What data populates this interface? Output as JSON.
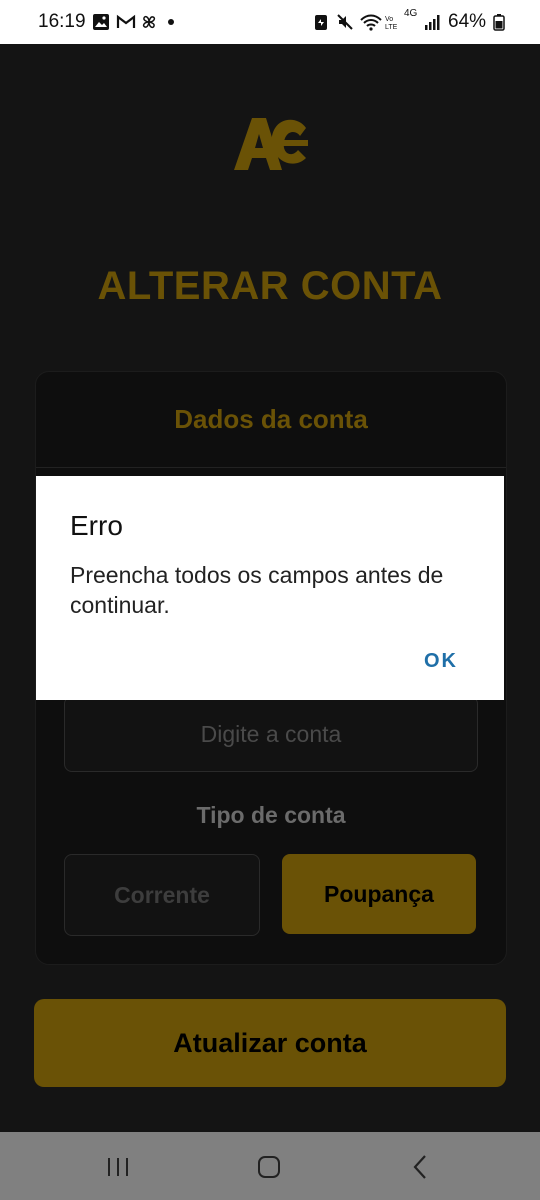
{
  "status_bar": {
    "time": "16:19",
    "battery": "64%",
    "network": "4G",
    "left_icons": [
      "image-icon",
      "gmail-icon",
      "pinwheel-icon",
      "notification-dot-icon"
    ],
    "right_icons": [
      "battery-saver-icon",
      "mute-icon",
      "wifi-icon",
      "volte-icon",
      "signal-icon",
      "battery-icon"
    ]
  },
  "app": {
    "logo_text": "AC",
    "title": "ALTERAR CONTA",
    "card": {
      "header": "Dados da conta",
      "account_placeholder": "Digite a conta",
      "type_label": "Tipo de conta",
      "options": [
        "Corrente",
        "Poupança"
      ],
      "selected_option": "Poupança"
    },
    "update_button": "Atualizar conta"
  },
  "dialog": {
    "title": "Erro",
    "message": "Preencha todos os campos antes de continuar.",
    "ok_label": "OK"
  },
  "nav_bar": {
    "buttons": [
      "recents-icon",
      "home-icon",
      "back-icon"
    ]
  },
  "colors": {
    "accent": "#6a5206",
    "background": "#141414",
    "dialog_button": "#1f6fa8"
  }
}
